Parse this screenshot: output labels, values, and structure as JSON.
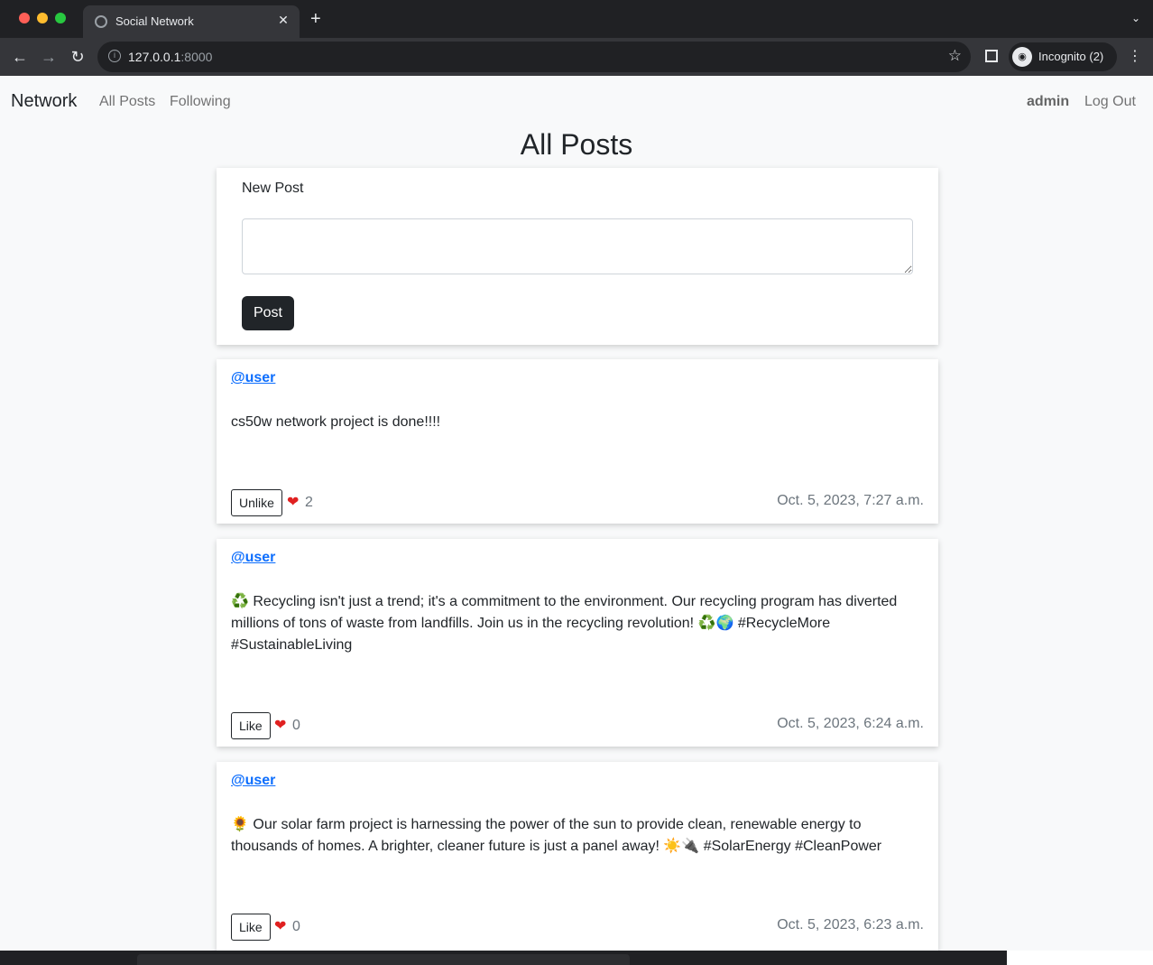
{
  "browser": {
    "tab_title": "Social Network",
    "tab_close": "✕",
    "new_tab": "+",
    "url_host": "127.0.0.1",
    "url_port": ":8000",
    "profile_label": "Incognito (2)"
  },
  "navbar": {
    "brand": "Network",
    "links": [
      "All Posts",
      "Following"
    ],
    "username": "admin",
    "logout": "Log Out"
  },
  "heading": "All Posts",
  "new_post": {
    "label": "New Post",
    "textarea_value": "",
    "button_label": "Post"
  },
  "posts": [
    {
      "author": "@user",
      "content": "cs50w network project is done!!!!",
      "like_button": "Unlike",
      "likes": "2",
      "timestamp": "Oct. 5, 2023, 7:27 a.m."
    },
    {
      "author": "@user",
      "content": "♻️ Recycling isn't just a trend; it's a commitment to the environment. Our recycling program has diverted millions of tons of waste from landfills. Join us in the recycling revolution! ♻️🌍 #RecycleMore #SustainableLiving",
      "like_button": "Like",
      "likes": "0",
      "timestamp": "Oct. 5, 2023, 6:24 a.m."
    },
    {
      "author": "@user",
      "content": "🌻 Our solar farm project is harnessing the power of the sun to provide clean, renewable energy to thousands of homes. A brighter, cleaner future is just a panel away! ☀️🔌 #SolarEnergy #CleanPower",
      "like_button": "Like",
      "likes": "0",
      "timestamp": "Oct. 5, 2023, 6:23 a.m."
    }
  ],
  "colors": {
    "link": "#0d6efd",
    "heart": "#e02020",
    "button_dark": "#212529"
  }
}
